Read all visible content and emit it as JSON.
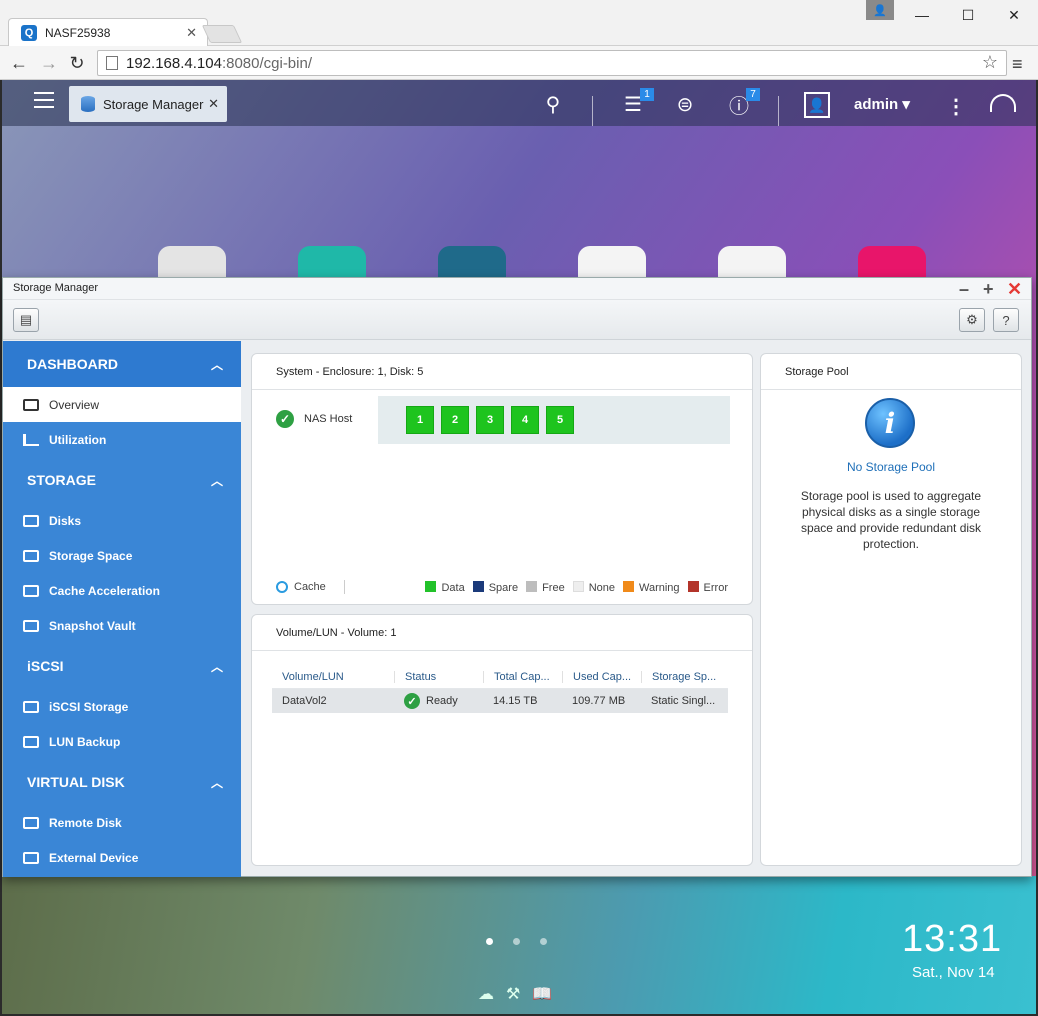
{
  "browser": {
    "tab_title": "NASF25938",
    "url_host": "192.168.4.104",
    "url_rest": ":8080/cgi-bin/"
  },
  "qts": {
    "app_tab": "Storage Manager",
    "notifications_badge": "1",
    "info_badge": "7",
    "user": "admin",
    "clock": "13:31",
    "date": "Sat., Nov 14"
  },
  "window": {
    "title": "Storage Manager"
  },
  "sidebar": {
    "sections": [
      {
        "label": "DASHBOARD",
        "items": [
          "Overview",
          "Utilization"
        ]
      },
      {
        "label": "STORAGE",
        "items": [
          "Disks",
          "Storage Space",
          "Cache Acceleration",
          "Snapshot Vault"
        ]
      },
      {
        "label": "iSCSI",
        "items": [
          "iSCSI Storage",
          "LUN Backup"
        ]
      },
      {
        "label": "VIRTUAL DISK",
        "items": [
          "Remote Disk",
          "External Device"
        ]
      }
    ]
  },
  "system_panel": {
    "title": "System - Enclosure: 1, Disk: 5",
    "host_label": "NAS Host",
    "disks": [
      "1",
      "2",
      "3",
      "4",
      "5"
    ],
    "legend_cache": "Cache",
    "legend": [
      {
        "label": "Data",
        "color": "#22c22a"
      },
      {
        "label": "Spare",
        "color": "#1b3a7a"
      },
      {
        "label": "Free",
        "color": "#bdbdbd"
      },
      {
        "label": "None",
        "color": "#eeeeee"
      },
      {
        "label": "Warning",
        "color": "#f08a1a"
      },
      {
        "label": "Error",
        "color": "#b3342a"
      }
    ]
  },
  "volume_panel": {
    "title": "Volume/LUN - Volume: 1",
    "columns": [
      "Volume/LUN",
      "Status",
      "Total Cap...",
      "Used Cap...",
      "Storage Sp..."
    ],
    "rows": [
      [
        "DataVol2",
        "Ready",
        "14.15 TB",
        "109.77 MB",
        "Static Singl..."
      ]
    ]
  },
  "pool_panel": {
    "title": "Storage Pool",
    "heading": "No Storage Pool",
    "description": "Storage pool is used to aggregate physical disks as a single storage space and provide redundant disk protection."
  }
}
